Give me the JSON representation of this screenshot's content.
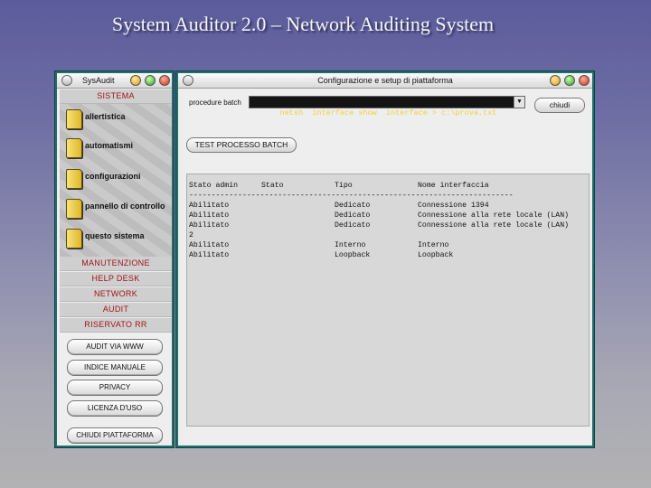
{
  "slide_title": "System Auditor 2.0 – Network Auditing System",
  "sidebar_window": {
    "title": "SysAudit",
    "sections": {
      "sistema": "SISTEMA",
      "manutenzione": "MANUTENZIONE",
      "help_desk": "HELP DESK",
      "network": "NETWORK",
      "audit": "AUDIT",
      "riservato": "RISERVATO RR"
    },
    "folders": [
      {
        "label": "allertistica"
      },
      {
        "label": "automatismi"
      },
      {
        "label": "configurazioni"
      },
      {
        "label": "pannello di controllo"
      },
      {
        "label": "questo sistema"
      }
    ],
    "buttons": {
      "audit_web": "AUDIT VIA WWW",
      "indice": "INDICE MANUALE",
      "privacy": "PRIVACY",
      "licenza": "LICENZA D'USO",
      "chiudi": "CHIUDI PIATTAFORMA"
    }
  },
  "main_window": {
    "title": "Configurazione e setup di piattaforma",
    "procedure_label": "procedure batch",
    "command_value": "netsh  interface show  interface > c:\\prova.txt",
    "close_label": "chiudi",
    "test_button": "TEST PROCESSO BATCH",
    "output": {
      "headers": [
        "Stato admin",
        "Stato",
        "Tipo",
        "Nome interfaccia"
      ],
      "separator": "-------------------------------------------------------------------------",
      "rows": [
        [
          "Abilitato",
          "",
          "Dedicato",
          "Connessione 1394"
        ],
        [
          "Abilitato",
          "",
          "Dedicato",
          "Connessione alla rete locale (LAN)"
        ],
        [
          "Abilitato",
          "",
          "Dedicato",
          "Connessione alla rete locale (LAN)"
        ],
        [
          "2",
          "",
          "",
          ""
        ],
        [
          "Abilitato",
          "",
          "Interno",
          "Interno"
        ],
        [
          "Abilitato",
          "",
          "Loopback",
          "Loopback"
        ]
      ]
    }
  }
}
